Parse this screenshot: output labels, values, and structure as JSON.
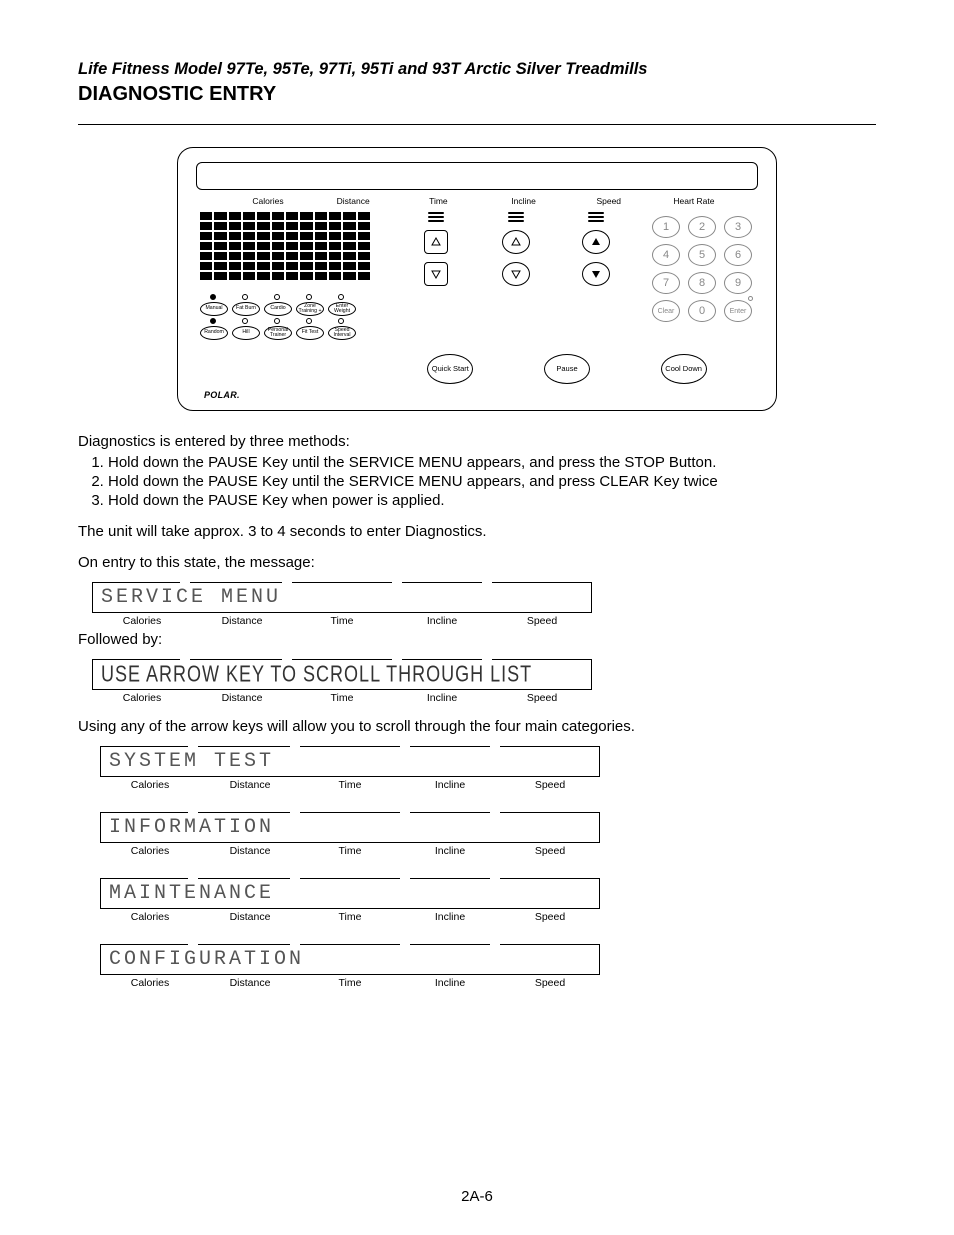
{
  "header": {
    "subtitle": "Life Fitness Model 97Te, 95Te, 97Ti, 95Ti and 93T Arctic Silver Treadmills",
    "title": "DIAGNOSTIC ENTRY"
  },
  "console": {
    "top_labels": [
      "Calories",
      "Distance",
      "Time",
      "Incline",
      "Speed",
      "Heart Rate"
    ],
    "programs_row1": [
      "Manual",
      "Fat Burn",
      "Cardio",
      "Zone Training +",
      "Enter Weight"
    ],
    "programs_row2": [
      "Random",
      "Hill",
      "Personal Trainer",
      "Fit Test",
      "Speed Interval"
    ],
    "action_buttons": [
      "Quick Start",
      "Pause",
      "Cool Down"
    ],
    "keypad": [
      "1",
      "2",
      "3",
      "4",
      "5",
      "6",
      "7",
      "8",
      "9",
      "Clear",
      "0",
      "Enter"
    ],
    "brand": "POLAR."
  },
  "body": {
    "intro": "Diagnostics is entered by three methods:",
    "steps": [
      "Hold down the PAUSE Key until the SERVICE MENU appears, and press the STOP Button.",
      "Hold down the PAUSE Key until the SERVICE MENU appears, and press CLEAR Key twice",
      "Hold down the PAUSE Key when power is applied."
    ],
    "delay": "The unit will take approx. 3 to 4 seconds to enter Diagnostics.",
    "entry_msg": "On entry to this state, the message:",
    "followed_by": "Followed by:",
    "scroll_note": "Using any of the arrow keys will allow you to scroll through the four main categories."
  },
  "displays": {
    "labels": [
      "Calories",
      "Distance",
      "Time",
      "Incline",
      "Speed"
    ],
    "d1": {
      "text": "SERVICE MENU",
      "style": "serif"
    },
    "d2": {
      "text": "USE ARROW KEY TO SCROLL THROUGH LIST",
      "style": "lcd"
    },
    "d3": {
      "text": "SYSTEM TEST",
      "style": "serif"
    },
    "d4": {
      "text": "INFORMATION",
      "style": "serif"
    },
    "d5": {
      "text": "MAINTENANCE",
      "style": "serif"
    },
    "d6": {
      "text": "CONFIGURATION",
      "style": "serif"
    }
  },
  "footer": {
    "page": "2A-6"
  }
}
